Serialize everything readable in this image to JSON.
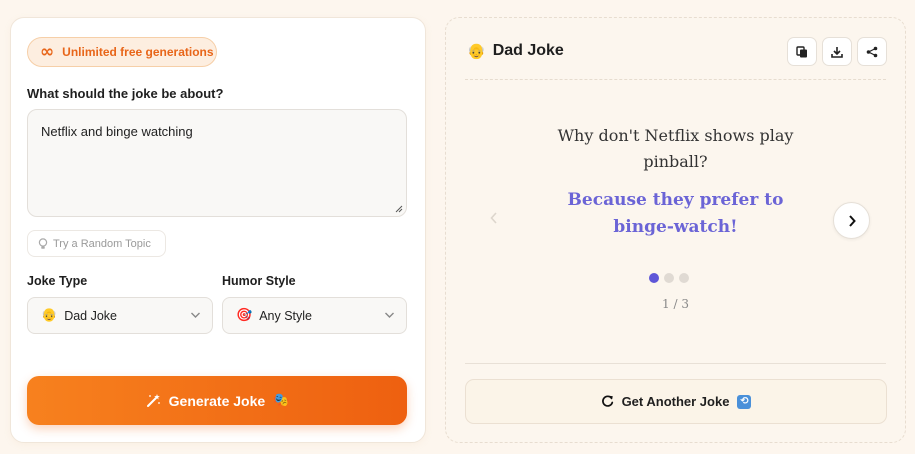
{
  "form": {
    "badge_label": "Unlimited free generations",
    "badge_icon": "infinity-icon",
    "topic_label": "What should the joke be about?",
    "topic_value": "Netflix and binge watching",
    "random_topic_label": "Try a Random Topic",
    "joke_type_label": "Joke Type",
    "joke_type_value": "Dad Joke",
    "humor_style_label": "Humor Style",
    "humor_style_value": "Any Style",
    "generate_label": "Generate Joke"
  },
  "result": {
    "title": "Dad Joke",
    "question": "Why don't Netflix shows play pinball?",
    "answer": "Because they prefer to binge-watch!",
    "pager_current": "1",
    "pager_total": "3",
    "another_label": "Get Another Joke",
    "actions": [
      "copy-icon",
      "download-icon",
      "share-icon"
    ]
  },
  "colors": {
    "accent_orange": "#ee6010",
    "answer_purple": "#6b64d6",
    "dot_active": "#5e56d8"
  }
}
